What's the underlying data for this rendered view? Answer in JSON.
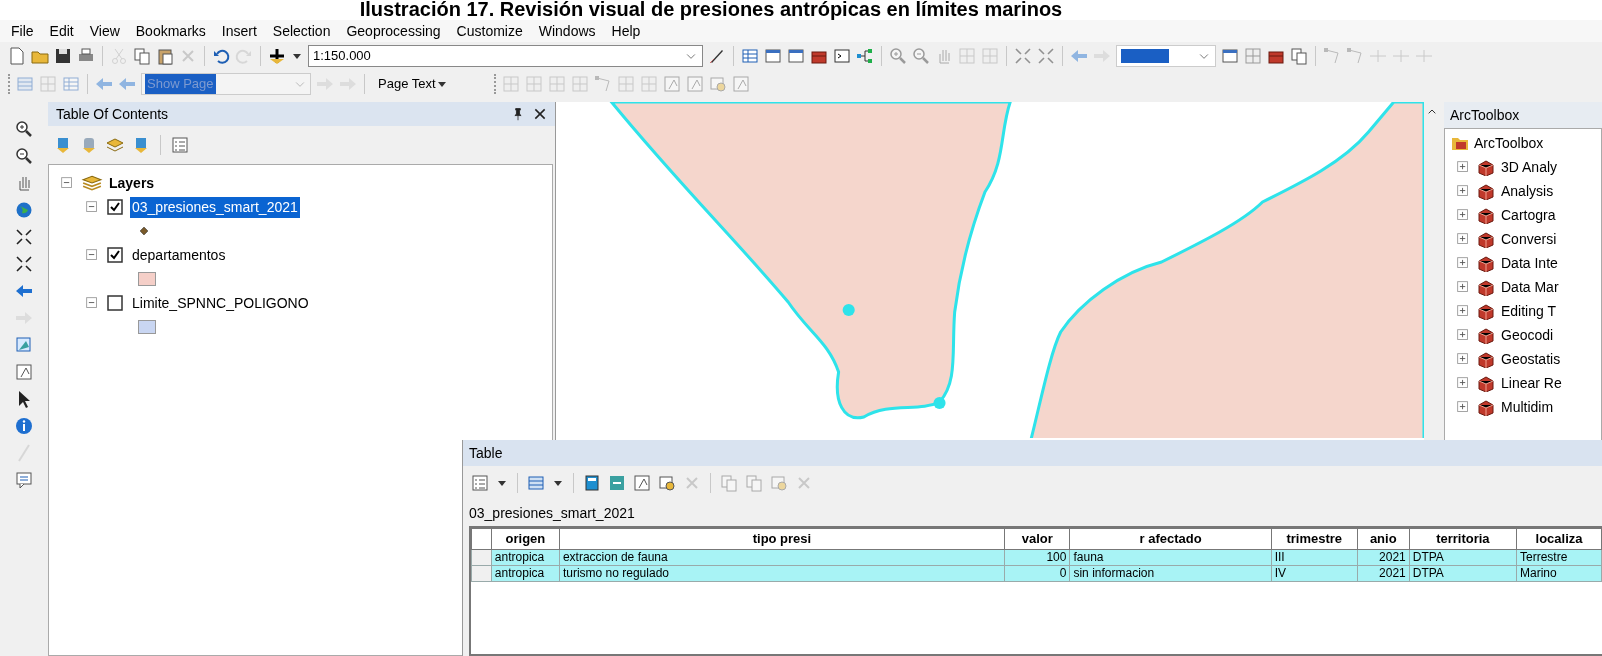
{
  "caption": "Ilustración 17. Revisión visual de presiones antrópicas en límites marinos",
  "menu": [
    "File",
    "Edit",
    "View",
    "Bookmarks",
    "Insert",
    "Selection",
    "Geoprocessing",
    "Customize",
    "Windows",
    "Help"
  ],
  "scale_field": {
    "value": "1:150.000"
  },
  "page_dropdown": {
    "value": "Show Page",
    "disabled": true
  },
  "page_text_button": {
    "label": "Page Text"
  },
  "toc": {
    "title": "Table Of Contents",
    "root": {
      "label": "Layers",
      "expanded": true,
      "children": [
        {
          "label": "03_presiones_smart_2021",
          "checked": true,
          "selected": true,
          "expanded": true,
          "legend": {
            "kind": "point",
            "color": "#7a5a2a"
          }
        },
        {
          "label": "departamentos",
          "checked": true,
          "selected": false,
          "expanded": true,
          "legend": {
            "kind": "fill",
            "color": "#f5cfc8"
          }
        },
        {
          "label": "Limite_SPNNC_POLIGONO",
          "checked": false,
          "selected": false,
          "expanded": true,
          "legend": {
            "kind": "fill",
            "color": "#c9d6f2"
          }
        }
      ]
    }
  },
  "toolbox": {
    "title": "ArcToolbox",
    "root": "ArcToolbox",
    "items": [
      {
        "label": "3D Analy",
        "expanded": false
      },
      {
        "label": "Analysis",
        "expanded": false
      },
      {
        "label": "Cartogra",
        "expanded": false
      },
      {
        "label": "Conversi",
        "expanded": false
      },
      {
        "label": "Data Inte",
        "expanded": false
      },
      {
        "label": "Data Mar",
        "expanded": false
      },
      {
        "label": "Editing T",
        "expanded": false
      },
      {
        "label": "Geocodi",
        "expanded": false
      },
      {
        "label": "Geostatis",
        "expanded": false
      },
      {
        "label": "Linear Re",
        "expanded": false
      },
      {
        "label": "Multidim",
        "expanded": false
      }
    ]
  },
  "table": {
    "title": "Table",
    "layer_tab": "03_presiones_smart_2021",
    "columns": [
      {
        "label": "origen",
        "kind": "text"
      },
      {
        "label": "tipo presi",
        "kind": "text"
      },
      {
        "label": "valor",
        "kind": "number"
      },
      {
        "label": "r afectado",
        "kind": "text"
      },
      {
        "label": "trimestre",
        "kind": "text"
      },
      {
        "label": "anio",
        "kind": "number"
      },
      {
        "label": "territoria",
        "kind": "text"
      },
      {
        "label": "localiza",
        "kind": "text"
      }
    ],
    "rows": [
      {
        "selected": true,
        "cells": [
          "antropica",
          "extraccion de fauna",
          "100",
          "fauna",
          "III",
          "2021",
          "DTPA",
          "Terrestre"
        ]
      },
      {
        "selected": true,
        "cells": [
          "antropica",
          "turismo no regulado",
          "0",
          "sin informacion",
          "IV",
          "2021",
          "DTPA",
          "Marino"
        ]
      }
    ]
  }
}
